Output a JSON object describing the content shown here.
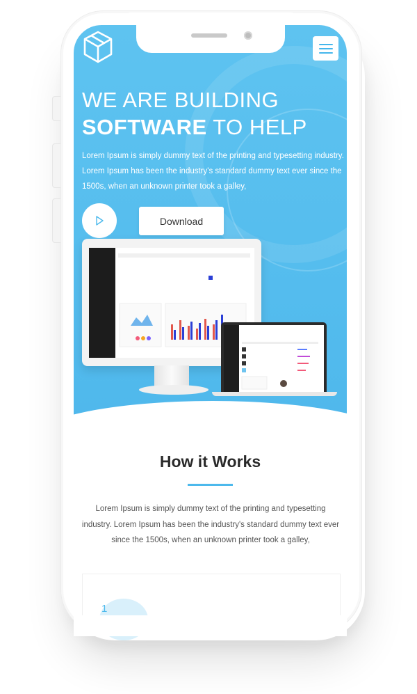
{
  "hero": {
    "headline_line1": "WE ARE BUILDING",
    "headline_bold": "SOFTWARE",
    "headline_rest": " TO HELP",
    "description": "Lorem Ipsum is simply dummy text of the printing and typesetting industry. Lorem Ipsum has been the industry's standard dummy text ever since the 1500s, when an unknown printer took a galley,",
    "download_label": "Download"
  },
  "how_it_works": {
    "title": "How it Works",
    "description": "Lorem Ipsum is simply dummy text of the printing and typesetting industry. Lorem Ipsum has been the industry's standard dummy text ever since the 1500s, when an unknown printer took a galley,",
    "step_number": "1"
  },
  "colors": {
    "accent": "#4db9ec",
    "hero_bg": "#5ec3f0"
  },
  "icons": [
    "logo-cube-icon",
    "menu-icon",
    "play-icon"
  ]
}
